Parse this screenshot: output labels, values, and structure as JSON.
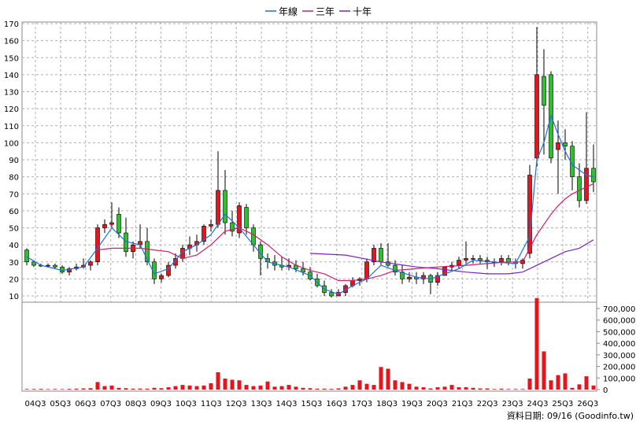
{
  "chart_data": {
    "type": "candlestick_with_volume",
    "legend": [
      {
        "name": "年線",
        "color": "#1f6fe0"
      },
      {
        "name": "三年",
        "color": "#d41c6c"
      },
      {
        "name": "十年",
        "color": "#7a22c8"
      }
    ],
    "price_axis": {
      "ylim": [
        0,
        170
      ],
      "ticks": [
        10,
        20,
        30,
        40,
        50,
        60,
        70,
        80,
        90,
        100,
        110,
        120,
        130,
        140,
        150,
        160,
        170
      ]
    },
    "volume_axis": {
      "ylim": [
        0,
        750000
      ],
      "ticks": [
        0,
        100000,
        200000,
        300000,
        400000,
        500000,
        600000,
        700000
      ],
      "tick_labels": [
        "0",
        "100,000",
        "200,000",
        "300,000",
        "400,000",
        "500,000",
        "600,000",
        "700,000"
      ]
    },
    "x_ticks": [
      "04Q3",
      "05Q3",
      "06Q3",
      "07Q3",
      "08Q3",
      "09Q3",
      "10Q3",
      "11Q3",
      "12Q3",
      "13Q3",
      "14Q3",
      "15Q3",
      "16Q3",
      "17Q3",
      "18Q3",
      "19Q3",
      "20Q3",
      "21Q3",
      "22Q3",
      "23Q3",
      "24Q3",
      "25Q3",
      "26Q3"
    ],
    "candles": [
      [
        37,
        38,
        28,
        30
      ],
      [
        30,
        31,
        27,
        28
      ],
      [
        28,
        29,
        27,
        28
      ],
      [
        28,
        29,
        27,
        28
      ],
      [
        28,
        29,
        26,
        27
      ],
      [
        27,
        28,
        23,
        24
      ],
      [
        24,
        27,
        22,
        26
      ],
      [
        26,
        29,
        25,
        27
      ],
      [
        27,
        32,
        26,
        28
      ],
      [
        28,
        31,
        25,
        30
      ],
      [
        30,
        52,
        28,
        50
      ],
      [
        50,
        55,
        47,
        52
      ],
      [
        52,
        65,
        50,
        53
      ],
      [
        58,
        62,
        44,
        47
      ],
      [
        47,
        56,
        33,
        36
      ],
      [
        36,
        42,
        32,
        40
      ],
      [
        40,
        52,
        38,
        42
      ],
      [
        42,
        50,
        28,
        30
      ],
      [
        30,
        32,
        17,
        20
      ],
      [
        20,
        23,
        18,
        22
      ],
      [
        22,
        30,
        21,
        28
      ],
      [
        28,
        35,
        26,
        32
      ],
      [
        32,
        40,
        30,
        38
      ],
      [
        38,
        45,
        34,
        40
      ],
      [
        40,
        46,
        36,
        42
      ],
      [
        42,
        52,
        40,
        51
      ],
      [
        51,
        55,
        48,
        52
      ],
      [
        52,
        95,
        50,
        72
      ],
      [
        72,
        84,
        46,
        53
      ],
      [
        53,
        60,
        45,
        48
      ],
      [
        47,
        65,
        44,
        63
      ],
      [
        62,
        64,
        46,
        50
      ],
      [
        50,
        52,
        36,
        40
      ],
      [
        40,
        42,
        22,
        32
      ],
      [
        32,
        35,
        26,
        30
      ],
      [
        30,
        34,
        25,
        28
      ],
      [
        28,
        33,
        25,
        27
      ],
      [
        27,
        32,
        25,
        28
      ],
      [
        28,
        31,
        24,
        26
      ],
      [
        26,
        30,
        22,
        24
      ],
      [
        24,
        27,
        19,
        20
      ],
      [
        20,
        23,
        15,
        16
      ],
      [
        16,
        19,
        10,
        12
      ],
      [
        12,
        14,
        9,
        10
      ],
      [
        10,
        14,
        10,
        12
      ],
      [
        12,
        17,
        10,
        16
      ],
      [
        16,
        21,
        15,
        19
      ],
      [
        19,
        21,
        16,
        20
      ],
      [
        20,
        32,
        18,
        30
      ],
      [
        30,
        40,
        28,
        38
      ],
      [
        38,
        41,
        28,
        30
      ],
      [
        30,
        41,
        27,
        28
      ],
      [
        28,
        31,
        22,
        24
      ],
      [
        24,
        28,
        17,
        20
      ],
      [
        20,
        24,
        18,
        21
      ],
      [
        21,
        24,
        17,
        20
      ],
      [
        20,
        24,
        17,
        22
      ],
      [
        22,
        23,
        11,
        18
      ],
      [
        18,
        24,
        16,
        22
      ],
      [
        22,
        27,
        22,
        27
      ],
      [
        27,
        30,
        25,
        28
      ],
      [
        28,
        33,
        26,
        31
      ],
      [
        31,
        42,
        29,
        32
      ],
      [
        32,
        34,
        29,
        32
      ],
      [
        32,
        34,
        29,
        31
      ],
      [
        31,
        33,
        26,
        30
      ],
      [
        30,
        32,
        27,
        30
      ],
      [
        30,
        34,
        28,
        32
      ],
      [
        32,
        34,
        28,
        30
      ],
      [
        30,
        32,
        26,
        29
      ],
      [
        29,
        32,
        26,
        31
      ],
      [
        35,
        87,
        32,
        81
      ],
      [
        91,
        168,
        86,
        140
      ],
      [
        139,
        155,
        93,
        122
      ],
      [
        140,
        142,
        88,
        91
      ],
      [
        96,
        113,
        70,
        100
      ],
      [
        100,
        108,
        90,
        98
      ],
      [
        98,
        101,
        72,
        80
      ],
      [
        80,
        88,
        62,
        66
      ],
      [
        66,
        118,
        64,
        85
      ],
      [
        85,
        99,
        71,
        77
      ]
    ],
    "volumes": [
      5000,
      5000,
      6000,
      4000,
      5000,
      4000,
      6000,
      8000,
      10000,
      12000,
      65000,
      30000,
      35000,
      15000,
      12000,
      8000,
      9000,
      8000,
      15000,
      12000,
      20000,
      30000,
      40000,
      35000,
      30000,
      35000,
      55000,
      150000,
      95000,
      85000,
      80000,
      40000,
      30000,
      35000,
      70000,
      25000,
      30000,
      40000,
      25000,
      15000,
      12000,
      8000,
      8000,
      6000,
      10000,
      25000,
      40000,
      80000,
      50000,
      40000,
      195000,
      180000,
      80000,
      65000,
      50000,
      25000,
      20000,
      10000,
      20000,
      25000,
      40000,
      20000,
      20000,
      15000,
      10000,
      10000,
      5000,
      8000,
      5000,
      5000,
      5000,
      95000,
      790000,
      330000,
      80000,
      125000,
      140000,
      15000,
      45000,
      115000,
      35000
    ],
    "ma_year": [
      [
        0,
        33
      ],
      [
        2,
        28
      ],
      [
        5,
        25
      ],
      [
        8,
        27
      ],
      [
        10,
        38
      ],
      [
        12,
        50
      ],
      [
        14,
        42
      ],
      [
        16,
        40
      ],
      [
        18,
        23
      ],
      [
        20,
        26
      ],
      [
        22,
        36
      ],
      [
        24,
        40
      ],
      [
        26,
        46
      ],
      [
        28,
        58
      ],
      [
        30,
        50
      ],
      [
        32,
        40
      ],
      [
        34,
        30
      ],
      [
        37,
        27
      ],
      [
        40,
        22
      ],
      [
        42,
        14
      ],
      [
        44,
        11
      ],
      [
        46,
        16
      ],
      [
        48,
        20
      ],
      [
        50,
        28
      ],
      [
        52,
        25
      ],
      [
        55,
        21
      ],
      [
        57,
        20
      ],
      [
        59,
        23
      ],
      [
        61,
        26
      ],
      [
        63,
        31
      ],
      [
        66,
        30
      ],
      [
        69,
        29
      ],
      [
        71,
        45
      ],
      [
        72,
        90
      ],
      [
        73,
        100
      ],
      [
        74,
        116
      ],
      [
        75,
        105
      ],
      [
        76,
        95
      ],
      [
        77,
        87
      ],
      [
        79,
        81
      ],
      [
        80,
        80
      ]
    ],
    "ma_3y": [
      [
        10,
        37
      ],
      [
        12,
        38
      ],
      [
        14,
        38
      ],
      [
        16,
        38
      ],
      [
        18,
        37
      ],
      [
        20,
        36
      ],
      [
        22,
        32
      ],
      [
        24,
        34
      ],
      [
        26,
        40
      ],
      [
        28,
        48
      ],
      [
        30,
        50
      ],
      [
        32,
        46
      ],
      [
        34,
        40
      ],
      [
        36,
        33
      ],
      [
        38,
        28
      ],
      [
        40,
        25
      ],
      [
        42,
        23
      ],
      [
        44,
        19
      ],
      [
        46,
        19
      ],
      [
        48,
        20
      ],
      [
        50,
        22
      ],
      [
        52,
        25
      ],
      [
        55,
        26
      ],
      [
        58,
        27
      ],
      [
        62,
        28
      ],
      [
        65,
        29
      ],
      [
        68,
        30
      ],
      [
        70,
        30
      ],
      [
        71,
        38
      ],
      [
        72,
        46
      ],
      [
        73,
        52
      ],
      [
        74,
        58
      ],
      [
        75,
        63
      ],
      [
        76,
        67
      ],
      [
        77,
        70
      ],
      [
        78,
        72
      ],
      [
        80,
        76
      ]
    ],
    "ma_10y": [
      [
        40,
        35
      ],
      [
        45,
        34
      ],
      [
        50,
        30
      ],
      [
        55,
        27
      ],
      [
        58,
        26
      ],
      [
        60,
        25
      ],
      [
        62,
        24
      ],
      [
        65,
        23
      ],
      [
        68,
        23
      ],
      [
        70,
        24
      ],
      [
        72,
        28
      ],
      [
        74,
        32
      ],
      [
        76,
        36
      ],
      [
        78,
        38
      ],
      [
        80,
        43
      ]
    ],
    "source_text": "資料日期: 09/16  (Goodinfo.tw)"
  }
}
